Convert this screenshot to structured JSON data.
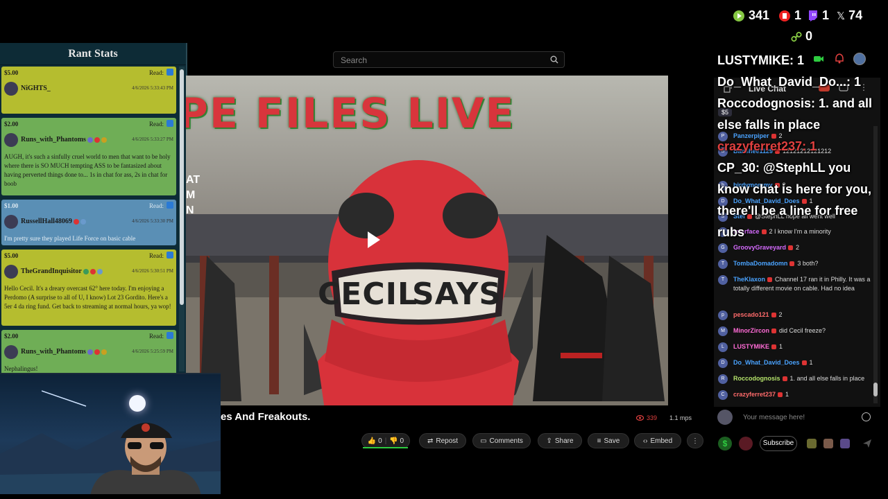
{
  "counters": {
    "rumble": "341",
    "youtube": "1",
    "twitch": "1",
    "x": "74",
    "link": "0"
  },
  "search": {
    "placeholder": "Search"
  },
  "rant_stats": {
    "title": "Rant Stats",
    "read_label": "Read:",
    "items": [
      {
        "amount": "$5.00",
        "user": "NiGHTS_",
        "time": "4/6/2026 5:33:43 PM",
        "message": "",
        "color": "#b5bd2f"
      },
      {
        "amount": "$2.00",
        "user": "Runs_with_Phantoms",
        "time": "4/6/2026 5:33:27 PM",
        "message": "AUGH, it's such a sinfully cruel world to men that want to be holy where there is SO MUCH tempting ASS to be fantasized about having perverted things done to... 1s in chat for ass, 2s in chat for boob",
        "color": "#6fae56"
      },
      {
        "amount": "$1.00",
        "user": "RussellHall48069",
        "time": "4/6/2026 5:33:30 PM",
        "message": "I'm pretty sure they played Life Force on basic cable",
        "color": "#5a8fb5"
      },
      {
        "amount": "$5.00",
        "user": "TheGrandInquisitor",
        "time": "4/6/2026 5:30:51 PM",
        "message": "Hello Cecil. It's a dreary overcast 62° here today. I'm enjoying a Perdomo (A surprise to all of U, I know) Lot 23 Gordito. Here's a 5er 4 da ring fund. Get back to streaming at normal hours, ya wop!",
        "color": "#b5bd2f"
      },
      {
        "amount": "$2.00",
        "user": "Runs_with_Phantoms",
        "time": "4/6/2026 5:25:59 PM",
        "message": "Nephalingus!",
        "color": "#6fae56"
      }
    ]
  },
  "video": {
    "title_text": "PE FILES LIVE",
    "mask_text_1": "CECIL",
    "mask_text_2": "SAYS",
    "side_text": [
      "AT",
      "M",
      "N"
    ]
  },
  "video_info": {
    "title": "es And Freakouts.",
    "viewers": "339",
    "mps": "1.1 mps"
  },
  "actions": {
    "likes": "0",
    "dislikes": "0",
    "repost": "Repost",
    "comments": "Comments",
    "share": "Share",
    "save": "Save",
    "embed": "Embed"
  },
  "chat": {
    "header": "Live Chat",
    "rant_amount": "$5",
    "messages": [
      {
        "initial": "P",
        "user": "Panzerpiper",
        "text": "2",
        "color": "#4aa3ff"
      },
      {
        "initial": "B",
        "user": "Banshee1129",
        "text": "12121212121212",
        "color": "#4aa3ff"
      },
      {
        "initial": "b",
        "user": "birdymommy",
        "text": "2",
        "color": "#4aa3ff"
      },
      {
        "initial": "D",
        "user": "Do_What_David_Does",
        "text": "1",
        "color": "#4aa3ff"
      },
      {
        "initial": "S",
        "user": "Stef",
        "text": "@StephLL hope all went well",
        "color": "#4aa3ff"
      },
      {
        "initial": "i",
        "user": "interface",
        "text": "2 I know I'm a minority",
        "color": "#d66bff"
      },
      {
        "initial": "G",
        "user": "GroovyGraveyard",
        "text": "2",
        "color": "#d66bff"
      },
      {
        "initial": "T",
        "user": "TombaDomadomn",
        "text": "3 both?",
        "color": "#4aa3ff"
      },
      {
        "initial": "T",
        "user": "TheKlaxon",
        "text": "Channel 17 ran it in Philly. It was a totally different movie on cable. Had no idea",
        "color": "#4aa3ff"
      },
      {
        "initial": "p",
        "user": "pescado121",
        "text": "2",
        "color": "#ff6b6b"
      },
      {
        "initial": "M",
        "user": "MinorZircon",
        "text": "did Cecil freeze?",
        "color": "#ff6bd6"
      },
      {
        "initial": "L",
        "user": "LUSTYMIKE",
        "text": "1",
        "color": "#ff6bd6"
      },
      {
        "initial": "D",
        "user": "Do_What_David_Does",
        "text": "1",
        "color": "#4aa3ff"
      },
      {
        "initial": "R",
        "user": "Roccodognosis",
        "text": "1. and all else falls in place",
        "color": "#b5e36b"
      },
      {
        "initial": "C",
        "user": "crazyferret237",
        "text": "1",
        "color": "#ff6b6b"
      }
    ],
    "input_placeholder": "Your message here!",
    "subscribe": "Subscribe"
  },
  "overlay": [
    {
      "text": "LUSTYMIKE: 1",
      "red": false
    },
    {
      "text": "Do_What_David_Do...: 1",
      "red": false
    },
    {
      "text": "Roccodognosis: 1. and all else falls in place",
      "red": false
    },
    {
      "text": "crazyferret237: 1",
      "red": true
    },
    {
      "text": "CP_30: @StephLL you know chat is here for you, there'll be a line for free rubs",
      "red": false
    }
  ]
}
